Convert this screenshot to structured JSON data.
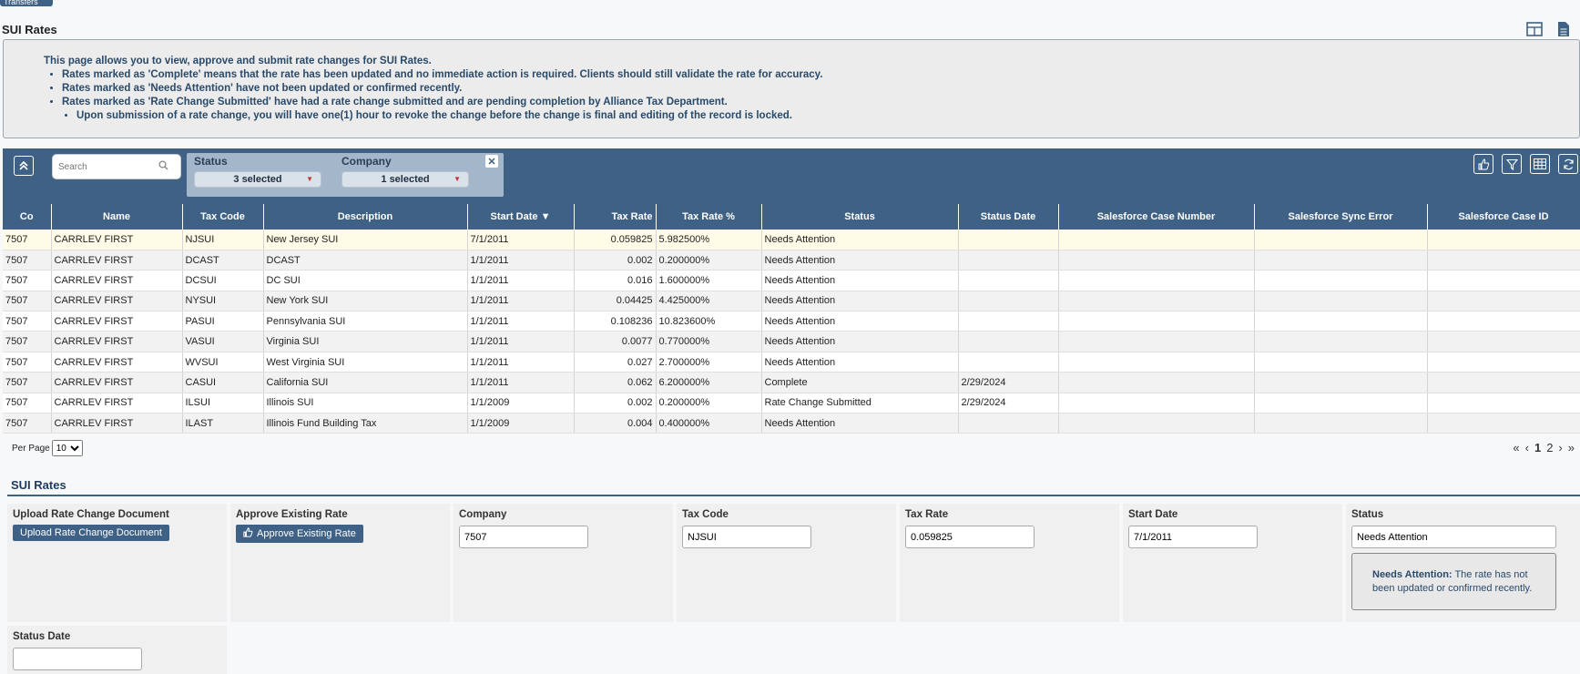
{
  "top_tab_label": "Transfers",
  "page_title": "SUI Rates",
  "info": {
    "intro": "This page allows you to view, approve and submit rate changes for SUI Rates.",
    "bullets": [
      "Rates marked as 'Complete' means that the rate has been updated and no immediate action is required. Clients should still validate the rate for accuracy.",
      "Rates marked as 'Needs Attention' have not been updated or confirmed recently.",
      "Rates marked as 'Rate Change Submitted' have had a rate change submitted and are pending completion by Alliance Tax Department."
    ],
    "sub_bullet": "Upon submission of a rate change, you will have one(1) hour to revoke the change before the change is final and editing of the record is locked."
  },
  "toolbar": {
    "search_placeholder": "Search",
    "status_label": "Status",
    "status_value": "3 selected",
    "company_label": "Company",
    "company_value": "1 selected"
  },
  "columns": [
    "Co",
    "Name",
    "Tax Code",
    "Description",
    "Start Date ▼",
    "Tax Rate",
    "Tax Rate %",
    "Status",
    "Status Date",
    "Salesforce Case Number",
    "Salesforce Sync Error",
    "Salesforce Case ID"
  ],
  "rows": [
    [
      "7507",
      "CARRLEV FIRST",
      "NJSUI",
      "New Jersey SUI",
      "7/1/2011",
      "0.059825",
      "5.982500%",
      "Needs Attention",
      "",
      "",
      "",
      ""
    ],
    [
      "7507",
      "CARRLEV FIRST",
      "DCAST",
      "DCAST",
      "1/1/2011",
      "0.002",
      "0.200000%",
      "Needs Attention",
      "",
      "",
      "",
      ""
    ],
    [
      "7507",
      "CARRLEV FIRST",
      "DCSUI",
      "DC SUI",
      "1/1/2011",
      "0.016",
      "1.600000%",
      "Needs Attention",
      "",
      "",
      "",
      ""
    ],
    [
      "7507",
      "CARRLEV FIRST",
      "NYSUI",
      "New York SUI",
      "1/1/2011",
      "0.04425",
      "4.425000%",
      "Needs Attention",
      "",
      "",
      "",
      ""
    ],
    [
      "7507",
      "CARRLEV FIRST",
      "PASUI",
      "Pennsylvania SUI",
      "1/1/2011",
      "0.108236",
      "10.823600%",
      "Needs Attention",
      "",
      "",
      "",
      ""
    ],
    [
      "7507",
      "CARRLEV FIRST",
      "VASUI",
      "Virginia SUI",
      "1/1/2011",
      "0.0077",
      "0.770000%",
      "Needs Attention",
      "",
      "",
      "",
      ""
    ],
    [
      "7507",
      "CARRLEV FIRST",
      "WVSUI",
      "West Virginia SUI",
      "1/1/2011",
      "0.027",
      "2.700000%",
      "Needs Attention",
      "",
      "",
      "",
      ""
    ],
    [
      "7507",
      "CARRLEV FIRST",
      "CASUI",
      "California SUI",
      "1/1/2011",
      "0.062",
      "6.200000%",
      "Complete",
      "2/29/2024",
      "",
      "",
      ""
    ],
    [
      "7507",
      "CARRLEV FIRST",
      "ILSUI",
      "Illinois SUI",
      "1/1/2009",
      "0.002",
      "0.200000%",
      "Rate Change Submitted",
      "2/29/2024",
      "",
      "",
      ""
    ],
    [
      "7507",
      "CARRLEV FIRST",
      "ILAST",
      "Illinois Fund Building Tax",
      "1/1/2009",
      "0.004",
      "0.400000%",
      "Needs Attention",
      "",
      "",
      "",
      ""
    ]
  ],
  "pagination": {
    "per_page_label": "Per Page",
    "per_page_value": "10",
    "first": "«",
    "prev": "‹",
    "page1": "1",
    "page2": "2",
    "next": "›",
    "last": "»"
  },
  "detail": {
    "section_title": "SUI Rates",
    "upload_label": "Upload Rate Change Document",
    "upload_button": "Upload Rate Change Document",
    "approve_label": "Approve Existing Rate",
    "approve_button": "Approve Existing Rate",
    "company_label": "Company",
    "company_value": "7507",
    "taxcode_label": "Tax Code",
    "taxcode_value": "NJSUI",
    "taxrate_label": "Tax Rate",
    "taxrate_value": "0.059825",
    "startdate_label": "Start Date",
    "startdate_value": "7/1/2011",
    "status_label": "Status",
    "status_value": "Needs Attention",
    "status_note_title": "Needs Attention:",
    "status_note_text": "The rate has not been updated or confirmed recently.",
    "statusdate_label": "Status Date",
    "statusdate_value": ""
  },
  "icons": {
    "layout": "grid-layout-icon",
    "document": "document-icon",
    "collapse": "collapse-up-icon",
    "search": "search-icon",
    "approve": "thumbs-up-icon",
    "filter": "filter-icon",
    "columns": "columns-grid-icon",
    "refresh": "refresh-icon"
  }
}
